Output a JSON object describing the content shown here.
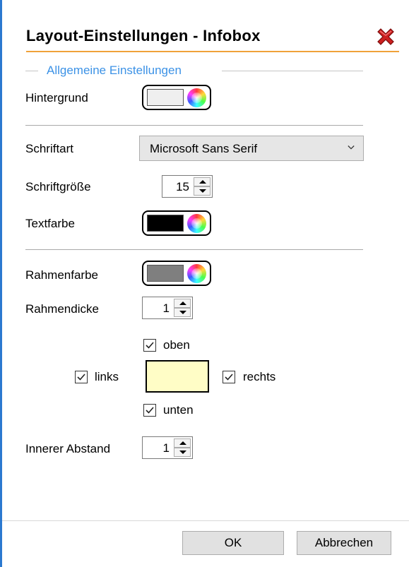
{
  "title": "Layout-Einstellungen - Infobox",
  "close_icon": "close-x-icon",
  "colors": {
    "accent_blue": "#2b79d0",
    "title_underline": "#f0a23a",
    "group_title": "#3c92e6",
    "close_red": "#cc2020",
    "background_swatch": "#efefef",
    "text_color_swatch": "#000000",
    "border_color_swatch": "#7f7f7f",
    "preview_fill": "#fffdc6"
  },
  "general": {
    "group_title": "Allgemeine Einstellungen",
    "background_label": "Hintergrund"
  },
  "font": {
    "font_label": "Schriftart",
    "font_value": "Microsoft Sans Serif",
    "size_label": "Schriftgröße",
    "size_value": "15",
    "text_color_label": "Textfarbe"
  },
  "border": {
    "color_label": "Rahmenfarbe",
    "thickness_label": "Rahmendicke",
    "thickness_value": "1",
    "top_label": "oben",
    "top_checked": true,
    "left_label": "links",
    "left_checked": true,
    "right_label": "rechts",
    "right_checked": true,
    "bottom_label": "unten",
    "bottom_checked": true,
    "padding_label": "Innerer Abstand",
    "padding_value": "1"
  },
  "footer": {
    "ok_label": "OK",
    "cancel_label": "Abbrechen"
  }
}
